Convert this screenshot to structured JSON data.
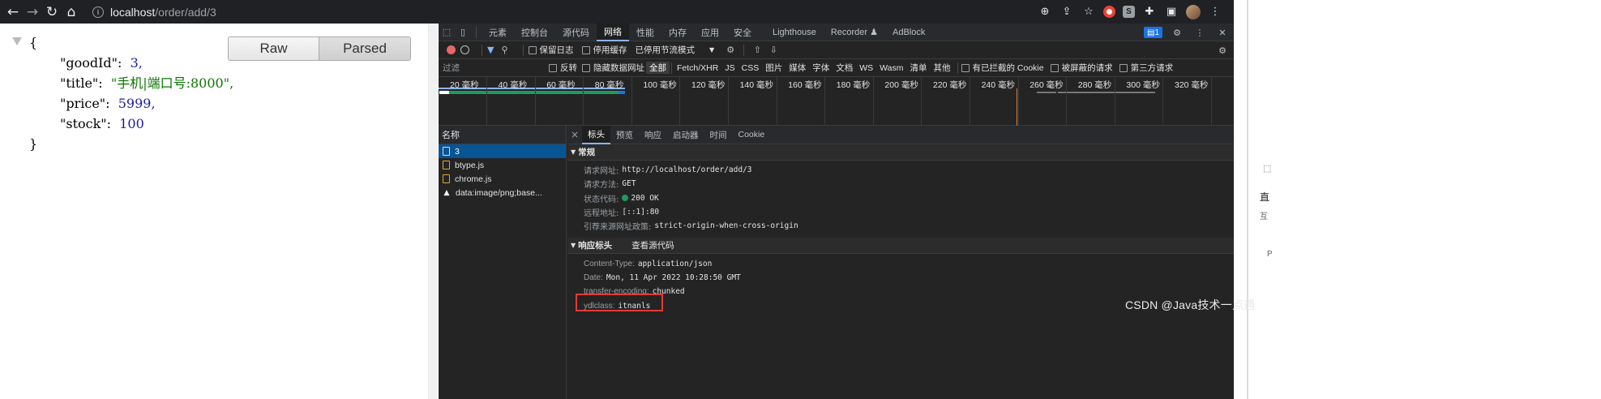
{
  "browser": {
    "url_host": "localhost",
    "url_path": "/order/add/3"
  },
  "page": {
    "toggle": {
      "raw": "Raw",
      "parsed": "Parsed"
    },
    "json": {
      "open": "{",
      "close": "}",
      "entries": [
        {
          "key": "\"goodId\":",
          "value": "3,",
          "type": "num"
        },
        {
          "key": "\"title\":",
          "value": "\"手机|端口号:8000\",",
          "type": "str"
        },
        {
          "key": "\"price\":",
          "value": "5999,",
          "type": "num"
        },
        {
          "key": "\"stock\":",
          "value": "100",
          "type": "num"
        }
      ]
    }
  },
  "devtools": {
    "tabs": [
      "元素",
      "控制台",
      "源代码",
      "网络",
      "性能",
      "内存",
      "应用",
      "安全",
      "Lighthouse",
      "Recorder ♟",
      "AdBlock"
    ],
    "active_tab": "网络",
    "issues_count": "1",
    "toolbar": {
      "preserve_log": "保留日志",
      "disable_cache": "停用缓存",
      "throttle": "已停用节流模式"
    },
    "filter": {
      "placeholder": "过滤",
      "invert": "反转",
      "hide_data_urls": "隐藏数据网址",
      "types": [
        "全部",
        "Fetch/XHR",
        "JS",
        "CSS",
        "图片",
        "媒体",
        "字体",
        "文档",
        "WS",
        "Wasm",
        "清单",
        "其他"
      ],
      "blocked_cookies": "有已拦截的 Cookie",
      "blocked_requests": "被屏蔽的请求",
      "third_party": "第三方请求"
    },
    "timeline_ticks": [
      "20 毫秒",
      "40 毫秒",
      "60 毫秒",
      "80 毫秒",
      "100 毫秒",
      "120 毫秒",
      "140 毫秒",
      "160 毫秒",
      "180 毫秒",
      "200 毫秒",
      "220 毫秒",
      "240 毫秒",
      "260 毫秒",
      "280 毫秒",
      "300 毫秒",
      "320 毫秒",
      "34"
    ],
    "names_header": "名称",
    "requests": [
      {
        "name": "3",
        "icon": "doc"
      },
      {
        "name": "btype.js",
        "icon": "js"
      },
      {
        "name": "chrome.js",
        "icon": "js"
      },
      {
        "name": "data:image/png;base...",
        "icon": "img"
      }
    ],
    "detail_tabs": [
      "标头",
      "预览",
      "响应",
      "启动器",
      "时间",
      "Cookie"
    ],
    "general": {
      "title": "常规",
      "rows": [
        {
          "k": "请求网址:",
          "v": "http://localhost/order/add/3"
        },
        {
          "k": "请求方法:",
          "v": "GET"
        },
        {
          "k": "状态代码:",
          "v": "200 OK"
        },
        {
          "k": "远程地址:",
          "v": "[::1]:80"
        },
        {
          "k": "引荐来源网址政策:",
          "v": "strict-origin-when-cross-origin"
        }
      ]
    },
    "response_headers": {
      "title": "响应标头",
      "view_source": "查看源代码",
      "rows": [
        {
          "k": "Content-Type:",
          "v": "application/json"
        },
        {
          "k": "Date:",
          "v": "Mon, 11 Apr 2022 10:28:50 GMT"
        },
        {
          "k": "transfer-encoding:",
          "v": "chunked"
        },
        {
          "k": "ydlclass:",
          "v": "itnanls"
        }
      ]
    }
  },
  "right_strip": {
    "t1": "直",
    "t2": "互",
    "t3": "P"
  },
  "watermark": "CSDN @Java技术一点通"
}
